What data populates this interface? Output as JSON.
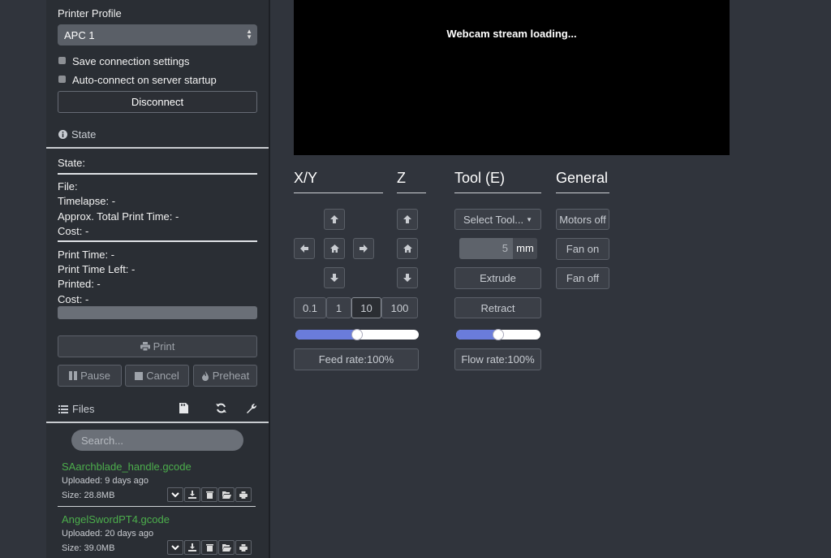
{
  "sidebar": {
    "printer_profile_label": "Printer Profile",
    "printer_profile_value": "APC 1",
    "save_connection_label": "Save connection settings",
    "auto_connect_label": "Auto-connect on server startup",
    "disconnect_label": "Disconnect",
    "state_section_label": "State",
    "state_label": "State:",
    "file_label": "File:",
    "timelapse_label": "Timelapse: -",
    "approx_total_label": "Approx. Total Print Time: -",
    "cost_label_1": "Cost: -",
    "print_time_label": "Print Time: -",
    "print_time_left_label": "Print Time Left: -",
    "printed_label": "Printed: -",
    "cost_label_2": "Cost: -",
    "progress": 0,
    "print_label": "Print",
    "pause_label": "Pause",
    "cancel_label": "Cancel",
    "preheat_label": "Preheat",
    "files_section_label": "Files",
    "search_placeholder": "Search...",
    "files": [
      {
        "name": "SAarchblade_handle.gcode",
        "uploaded": "Uploaded: 9 days ago",
        "size": "Size: 28.8MB"
      },
      {
        "name": "AngelSwordPT4.gcode",
        "uploaded": "Uploaded: 20 days ago",
        "size": "Size: 39.0MB"
      }
    ]
  },
  "webcam": {
    "status": "Webcam stream loading..."
  },
  "controls": {
    "xy_title": "X/Y",
    "z_title": "Z",
    "tool_title": "Tool (E)",
    "general_title": "General",
    "step_options": [
      "0.1",
      "1",
      "10",
      "100"
    ],
    "step_selected": "10",
    "feed_rate_label": "Feed rate:100%",
    "feed_rate_fraction": 0.5,
    "select_tool_label": "Select Tool...",
    "extrude_amount": "5",
    "extrude_unit": "mm",
    "extrude_label": "Extrude",
    "retract_label": "Retract",
    "flow_rate_label": "Flow rate:100%",
    "flow_rate_fraction": 0.5,
    "motors_off_label": "Motors off",
    "fan_on_label": "Fan on",
    "fan_off_label": "Fan off"
  }
}
